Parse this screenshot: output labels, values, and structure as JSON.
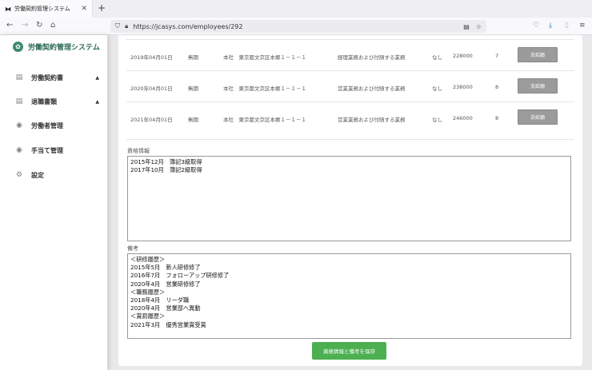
{
  "browser": {
    "tab_title": "労働契約管理システム",
    "url": "https://jcasys.com/employees/292"
  },
  "sidebar": {
    "brand": "労働契約管理システム",
    "items": [
      {
        "label": "労働契約書",
        "icon": "document-icon",
        "caret": "▲"
      },
      {
        "label": "退職書類",
        "icon": "document-icon",
        "caret": "▲"
      },
      {
        "label": "労働者管理",
        "icon": "user-icon"
      },
      {
        "label": "手当て管理",
        "icon": "user-icon"
      },
      {
        "label": "設定",
        "icon": "gear-icon"
      }
    ]
  },
  "history": {
    "rows": [
      {
        "date": "2019年04月01日",
        "period": "無期",
        "place": "本社　東京都文京区本郷１－１－１",
        "work": "経理業務および付随する業務",
        "overtime": "なし",
        "salary": "228000",
        "grade": "7",
        "button": "支給額"
      },
      {
        "date": "2020年04月01日",
        "period": "無期",
        "place": "本社　東京都文京区本郷１－１－１",
        "work": "営業業務および付随する業務",
        "overtime": "なし",
        "salary": "238000",
        "grade": "8",
        "button": "支給額"
      },
      {
        "date": "2021年04月01日",
        "period": "無期",
        "place": "本社　東京都文京区本郷１－１－１",
        "work": "営業業務および付随する業務",
        "overtime": "なし",
        "salary": "246000",
        "grade": "8",
        "button": "支給額"
      }
    ]
  },
  "qualifications": {
    "label": "資格情報",
    "lines": [
      "2015年12月　簿記3級取得",
      "2017年10月　簿記2級取得"
    ]
  },
  "remarks": {
    "label": "備考",
    "lines": [
      "＜研修履歴＞",
      "2015年5月　新人研修修了",
      "2016年7月　フォローアップ研修修了",
      "2020年4月　営業研修修了",
      "＜職務履歴＞",
      "2018年4月　リーダ職",
      "2020年4月　営業部へ異動",
      "＜賞罰履歴＞",
      "2021年3月　優秀営業賞受賞"
    ]
  },
  "save_button": "資格情報と備考を保存",
  "colors": {
    "brand": "#2c6b57",
    "save": "#4caf50",
    "pay_button": "#9b9b9b"
  }
}
